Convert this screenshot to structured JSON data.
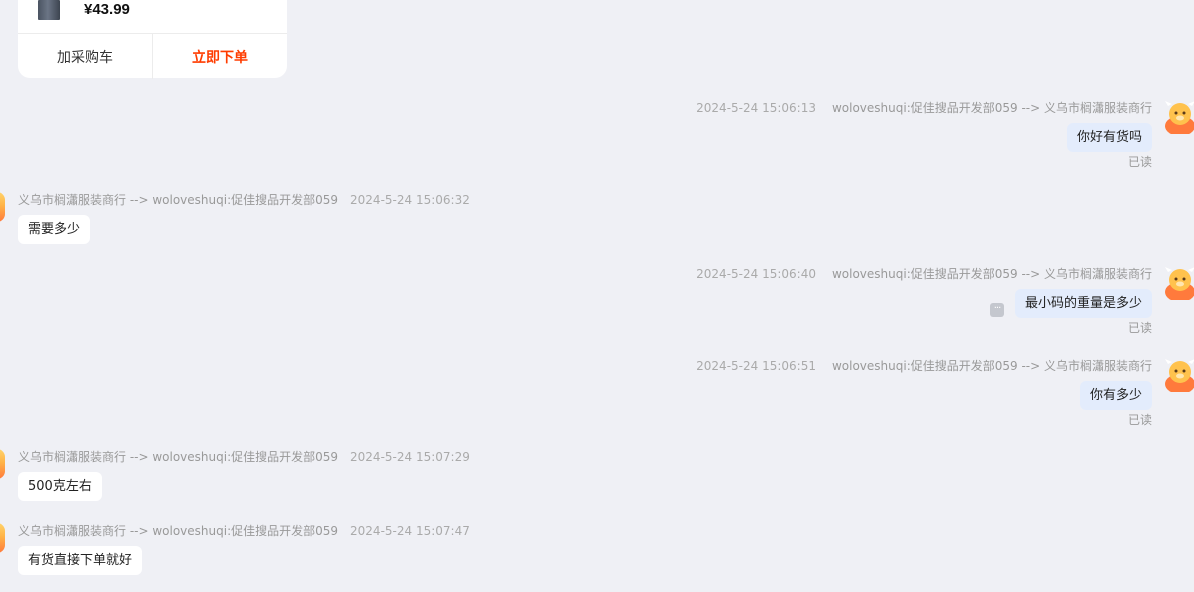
{
  "product": {
    "price": "¥43.99",
    "add_to_cart": "加采购车",
    "buy_now": "立即下单"
  },
  "messages": [
    {
      "direction": "out",
      "sender": "woloveshuqi:促佳搜品开发部059 --> 义乌市榈瀟服装商行",
      "timestamp": "2024-5-24 15:06:13",
      "text": "你好有货吗",
      "read": "已读"
    },
    {
      "direction": "in",
      "sender": "义乌市榈瀟服装商行 --> woloveshuqi:促佳搜品开发部059",
      "timestamp": "2024-5-24 15:06:32",
      "text": "需要多少"
    },
    {
      "direction": "out",
      "sender": "woloveshuqi:促佳搜品开发部059 --> 义乌市榈瀟服装商行",
      "timestamp": "2024-5-24 15:06:40",
      "text": "最小码的重量是多少",
      "read": "已读"
    },
    {
      "direction": "out",
      "sender": "woloveshuqi:促佳搜品开发部059 --> 义乌市榈瀟服装商行",
      "timestamp": "2024-5-24 15:06:51",
      "text": "你有多少",
      "read": "已读"
    },
    {
      "direction": "in",
      "sender": "义乌市榈瀟服装商行 --> woloveshuqi:促佳搜品开发部059",
      "timestamp": "2024-5-24 15:07:29",
      "text": "500克左右"
    },
    {
      "direction": "in",
      "sender": "义乌市榈瀟服装商行 --> woloveshuqi:促佳搜品开发部059",
      "timestamp": "2024-5-24 15:07:47",
      "text": "有货直接下单就好"
    }
  ],
  "icons": {
    "more": "more-dots-icon",
    "avatar": "cow-mascot-avatar"
  },
  "colors": {
    "background": "#eff0f5",
    "accent": "#ff3c00",
    "outgoing_bubble": "#e3ecfc",
    "incoming_bubble": "#ffffff"
  }
}
